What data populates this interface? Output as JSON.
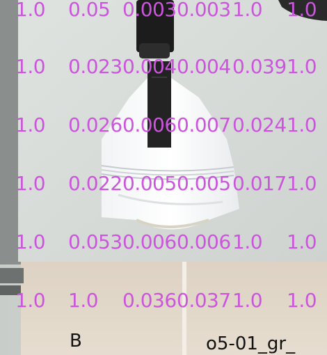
{
  "overlay": {
    "text_color": "#cc55dd",
    "rows": [
      [
        "1.0",
        "0.05",
        "0.003",
        "0.003",
        "1.0",
        "1.0"
      ],
      [
        "1.0",
        "0.023",
        "0.004",
        "0.004",
        "0.039",
        "1.0"
      ],
      [
        "1.0",
        "0.026",
        "0.006",
        "0.007",
        "0.024",
        "1.0"
      ],
      [
        "1.0",
        "0.022",
        "0.005",
        "0.005",
        "0.017",
        "1.0"
      ],
      [
        "1.0",
        "0.053",
        "0.006",
        "0.006",
        "1.0",
        "1.0"
      ],
      [
        "1.0",
        "1.0",
        "0.036",
        "0.037",
        "1.0",
        "1.0"
      ]
    ]
  },
  "labels": {
    "left": "B",
    "right": "o5-01_gr_"
  }
}
